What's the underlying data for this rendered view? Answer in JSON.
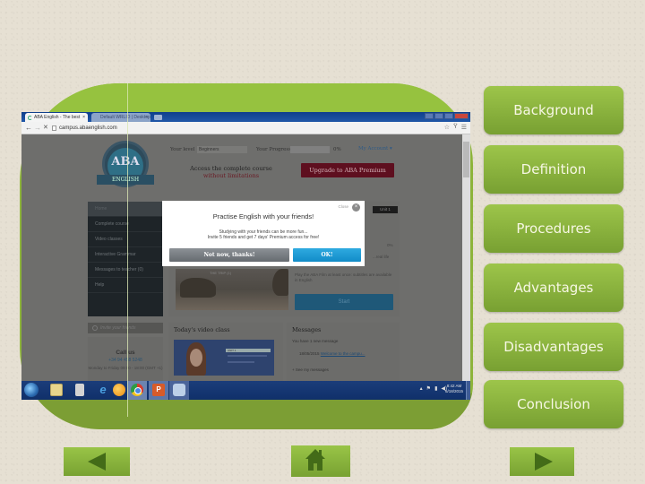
{
  "browser": {
    "tabs": [
      {
        "label": "ABA English - The best w...",
        "active": true
      },
      {
        "label": "Default WRLID | Desktop",
        "active": false
      }
    ],
    "url": "campus.abaenglish.com",
    "nav": {
      "back": "←",
      "forward": "→",
      "stop": "✕"
    },
    "addr_icons": {
      "star": "☆",
      "ext": "Ÿ",
      "menu": "☰"
    }
  },
  "site": {
    "logo": {
      "text": "ABA",
      "ribbon": "ENGLISH",
      "ring": "AMERICAN & BRITISH ACADEMY"
    },
    "header": {
      "level_label": "Your level",
      "level_value": "Beginners",
      "progress_label": "Your Progress",
      "progress_pct": "0%",
      "account": "My Account ▾"
    },
    "promo": {
      "line1": "Access the complete course",
      "line2": "without limitations"
    },
    "upgrade_button": "Upgrade to ABA Premium",
    "sidebar": [
      {
        "label": "Home",
        "active": true
      },
      {
        "label": "Complete course"
      },
      {
        "label": "Video classes"
      },
      {
        "label": "Interactive Grammar"
      },
      {
        "label": "Messages to teacher (0)"
      },
      {
        "label": "Help"
      }
    ],
    "invite_button": "Invite your friends",
    "contact": {
      "title": "Call us",
      "phone": "+34 94 458 5248",
      "hours": "Monday to Friday 09:00 - 18:00 (GMT +1)"
    },
    "unit_badge": "Unit 1",
    "course": {
      "image_caption": "THE TRIP (1)",
      "progress_pct": "0%",
      "side_text": "...real life",
      "description": "Play the ABA Film at least once: subtitles are available in English",
      "start_button": "Start"
    },
    "video_panel": {
      "title": "Today's video class",
      "unit": "UNIT 1"
    },
    "messages": {
      "title": "Messages",
      "summary": "You have 1 new message",
      "entry_date": "18/05/2015",
      "entry_link": "Welcome to the campu...",
      "more": "+ See my messages"
    }
  },
  "modal": {
    "close_label": "Close",
    "close_icon": "×",
    "title": "Practise English with your friends!",
    "line1": "Studying with your friends can be more fun...",
    "line2": "Invite 5 friends and get 7 days' Premium access for free!",
    "decline_button": "Not now, thanks!",
    "ok_button": "OK!"
  },
  "taskbar": {
    "apps": [
      "start",
      "explorer",
      "media-player",
      "internet-explorer",
      "firefox",
      "chrome",
      "powerpoint",
      "other"
    ],
    "ppt_label": "P",
    "ie_label": "e",
    "tray": {
      "arrow": "▴",
      "flag": "⚑",
      "battery": "▮",
      "volume": "◀)"
    },
    "time": "8:42 AM",
    "date": "5/18/2015"
  },
  "slide_nav": {
    "buttons": [
      "Background",
      "Definition",
      "Procedures",
      "Advantages",
      "Disadvantages",
      "Conclusion"
    ],
    "prev_label": "previous",
    "home_label": "home",
    "next_label": "next"
  },
  "colors": {
    "frame_green": "#8db43a",
    "button_green_top": "#9dc54a",
    "button_green_bottom": "#78a032",
    "icon_dark_green": "#436b18",
    "upgrade_maroon": "#5e0f1f",
    "ok_blue": "#2eaae0"
  }
}
